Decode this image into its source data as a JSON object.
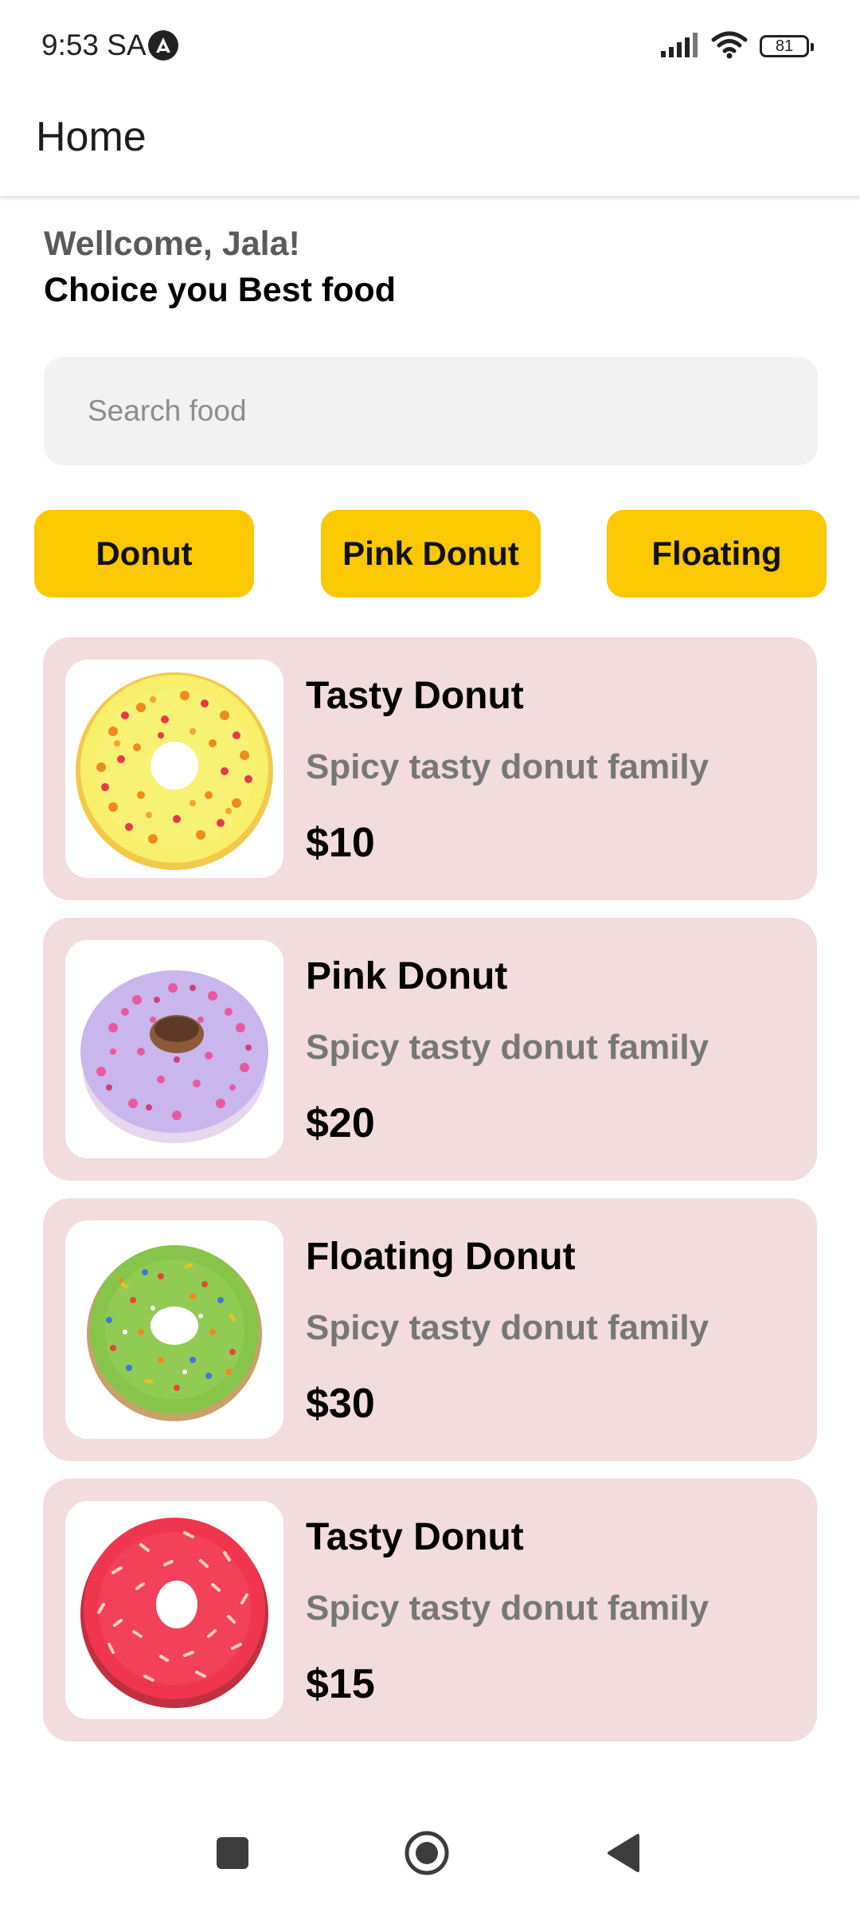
{
  "status_bar": {
    "time": "9:53 SA",
    "battery": "81"
  },
  "app_bar": {
    "title": "Home"
  },
  "greeting": "Wellcome, Jala!",
  "subtitle": "Choice you Best food",
  "search": {
    "placeholder": "Search food",
    "value": ""
  },
  "chips": [
    {
      "label": "Donut"
    },
    {
      "label": "Pink Donut"
    },
    {
      "label": "Floating"
    }
  ],
  "products": [
    {
      "title": "Tasty Donut",
      "description": "Spicy tasty donut family",
      "price": "$10",
      "image": "yellow-sprinkle-donut"
    },
    {
      "title": "Pink Donut",
      "description": "Spicy tasty donut family",
      "price": "$20",
      "image": "pink-sprinkle-donut"
    },
    {
      "title": "Floating Donut",
      "description": "Spicy tasty donut family",
      "price": "$30",
      "image": "green-sprinkle-donut"
    },
    {
      "title": "Tasty Donut",
      "description": "Spicy tasty donut family",
      "price": "$15",
      "image": "red-sprinkle-donut"
    }
  ],
  "colors": {
    "chip_background": "#fcc802",
    "card_background": "#f3dcdd",
    "search_background": "#f2f2f2"
  },
  "icons": {
    "nav_recent": "square-icon",
    "nav_home": "circle-home-icon",
    "nav_back": "triangle-back-icon"
  }
}
